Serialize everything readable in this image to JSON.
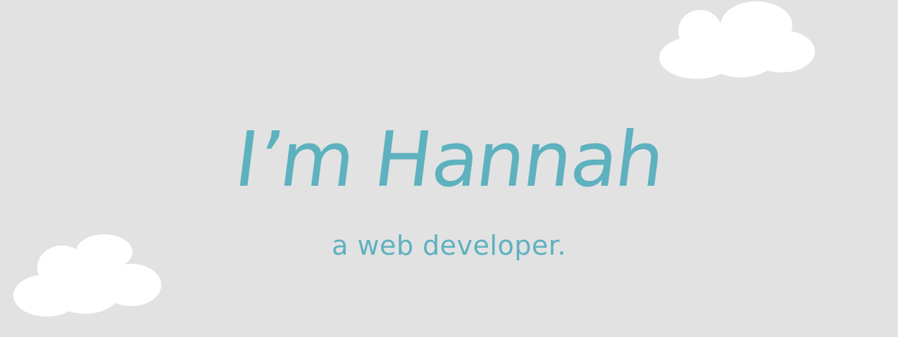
{
  "hero": {
    "headline": "I’m Hannah",
    "subheadline": "a web developer."
  },
  "colors": {
    "background": "#e2e2e2",
    "accent": "#5eb1bf",
    "cloud": "#ffffff"
  },
  "icons": {
    "cloud_top_right": "cloud-icon",
    "cloud_bottom_left": "cloud-icon"
  }
}
